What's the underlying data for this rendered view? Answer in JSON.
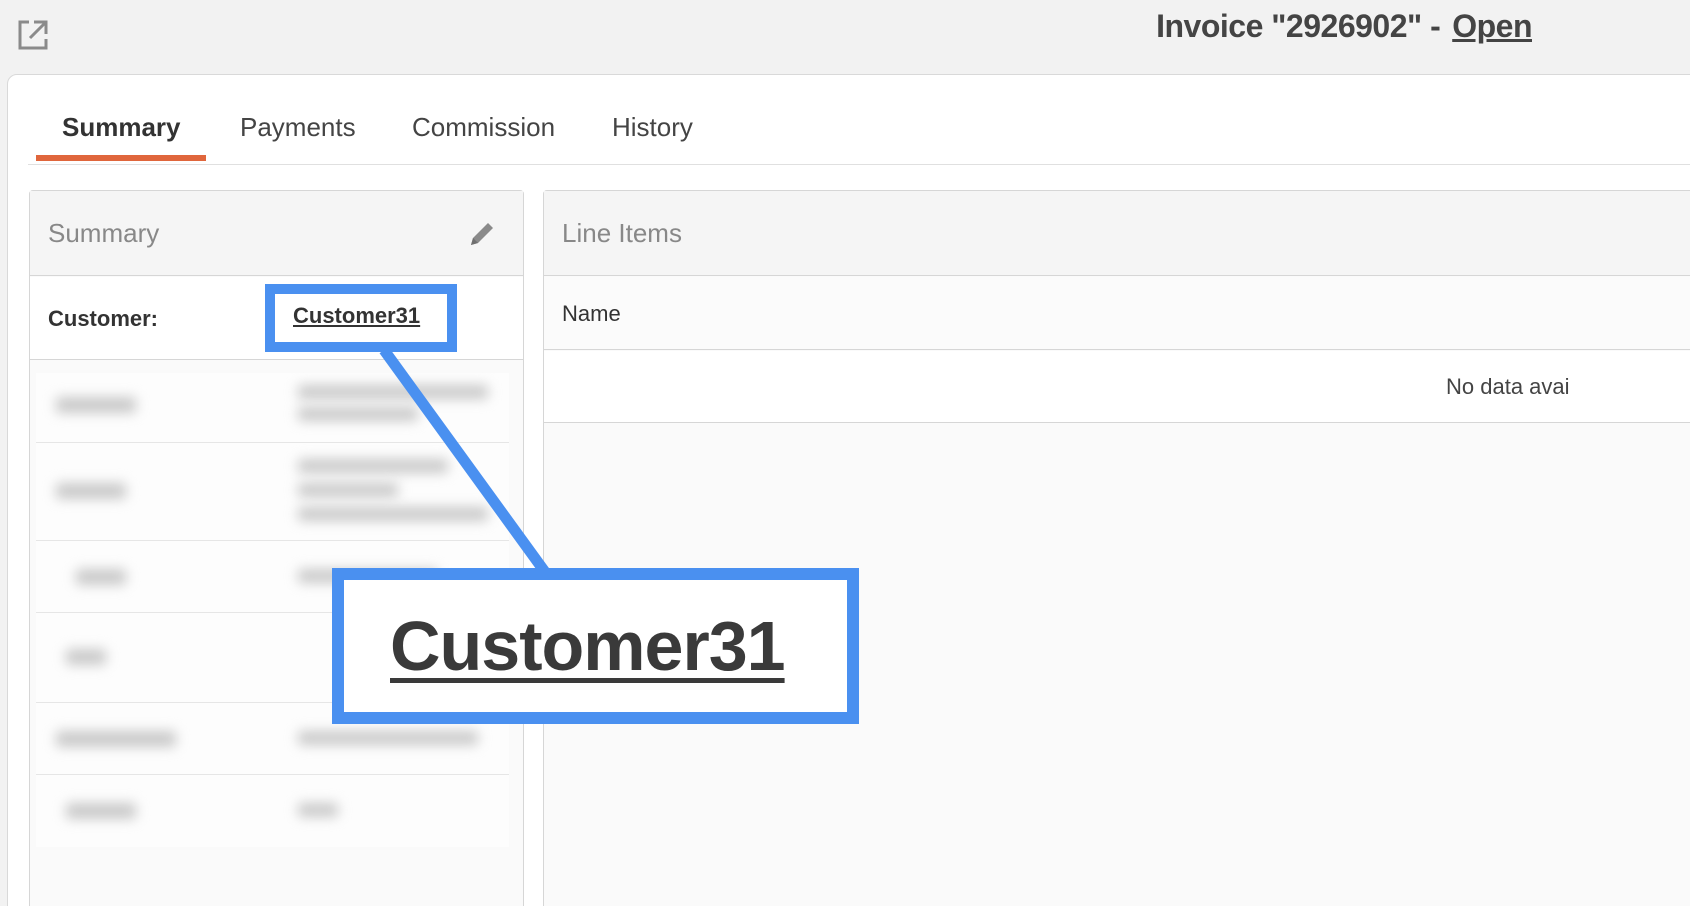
{
  "header": {
    "popout_icon": "external-link-icon",
    "invoice_label": "Invoice \"2926902\" -",
    "status_label": "Open"
  },
  "tabs": [
    {
      "label": "Summary",
      "active": true
    },
    {
      "label": "Payments",
      "active": false
    },
    {
      "label": "Commission",
      "active": false
    },
    {
      "label": "History",
      "active": false
    }
  ],
  "summary_panel": {
    "title": "Summary",
    "edit_icon": "pencil-icon",
    "customer_label": "Customer:",
    "customer_value": "Customer31"
  },
  "line_items_panel": {
    "title": "Line Items",
    "column_name": "Name",
    "empty_text": "No data avai"
  },
  "callout": {
    "text": "Customer31"
  },
  "colors": {
    "accent_tab": "#e0663c",
    "highlight": "#4a90f0"
  }
}
